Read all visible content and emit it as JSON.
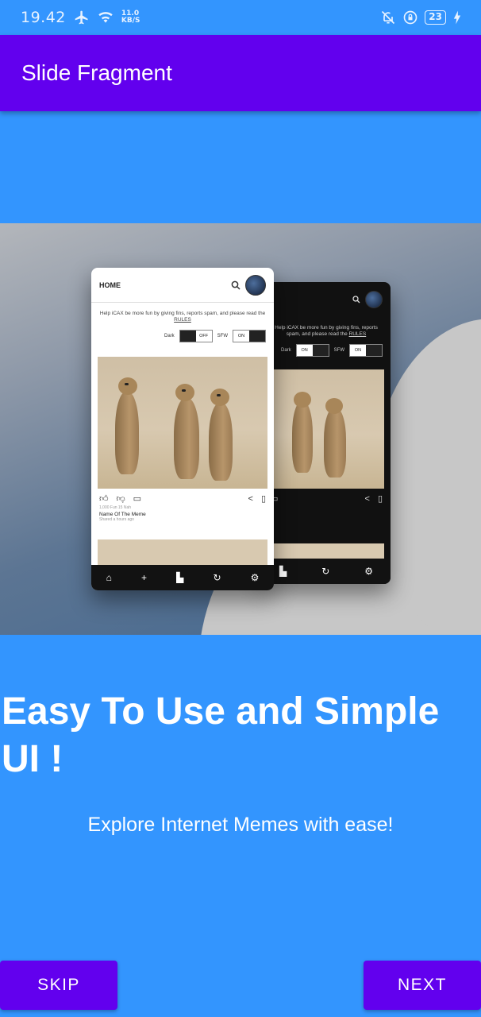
{
  "status_bar": {
    "time": "19.42",
    "net_speed_value": "11.0",
    "net_speed_unit": "KB/S",
    "battery": "23",
    "icons": [
      "airplane-icon",
      "wifi-icon",
      "mute-icon",
      "rotation-lock-icon",
      "battery-icon",
      "charging-icon"
    ]
  },
  "app_bar": {
    "title": "Slide Fragment"
  },
  "preview": {
    "light_phone": {
      "header": "HOME",
      "help_text": "Help iCAX be more fun by giving fins, reports spam, and please read the",
      "rules_link": "RULES",
      "dark_label": "Dark",
      "dark_toggle_on": "",
      "dark_toggle_off": "OFF",
      "sfw_label": "SFW",
      "sfw_toggle_on": "ON",
      "post_meta": "1,000 Fun   15 Nah",
      "post_name": "Name Of The Meme",
      "post_time": "Shared a hours ago"
    },
    "dark_phone": {
      "help_text": "Help iCAX be more fun by giving fins, reports spam, and please read the",
      "rules_link": "RULES",
      "dark_label": "Dark",
      "dark_toggle_on": "ON",
      "sfw_label": "SFW",
      "sfw_toggle_on": "ON"
    }
  },
  "headline": "Easy To Use and Simple UI !",
  "subtitle": "Explore Internet Memes with ease!",
  "buttons": {
    "skip": "SKIP",
    "next": "NEXT"
  },
  "colors": {
    "background": "#3395fe",
    "app_bar": "#6200ee",
    "button": "#6200ee"
  }
}
